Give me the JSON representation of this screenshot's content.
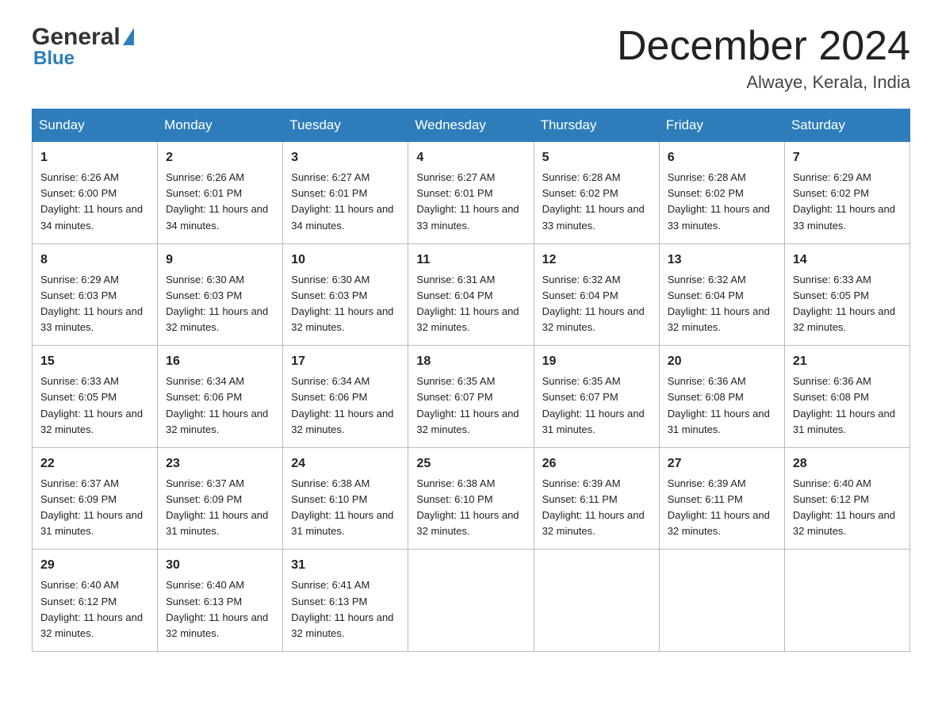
{
  "header": {
    "logo_general": "General",
    "logo_blue": "Blue",
    "month_title": "December 2024",
    "location": "Alwaye, Kerala, India"
  },
  "days_of_week": [
    "Sunday",
    "Monday",
    "Tuesday",
    "Wednesday",
    "Thursday",
    "Friday",
    "Saturday"
  ],
  "weeks": [
    [
      {
        "num": "1",
        "sunrise": "6:26 AM",
        "sunset": "6:00 PM",
        "daylight": "11 hours and 34 minutes."
      },
      {
        "num": "2",
        "sunrise": "6:26 AM",
        "sunset": "6:01 PM",
        "daylight": "11 hours and 34 minutes."
      },
      {
        "num": "3",
        "sunrise": "6:27 AM",
        "sunset": "6:01 PM",
        "daylight": "11 hours and 34 minutes."
      },
      {
        "num": "4",
        "sunrise": "6:27 AM",
        "sunset": "6:01 PM",
        "daylight": "11 hours and 33 minutes."
      },
      {
        "num": "5",
        "sunrise": "6:28 AM",
        "sunset": "6:02 PM",
        "daylight": "11 hours and 33 minutes."
      },
      {
        "num": "6",
        "sunrise": "6:28 AM",
        "sunset": "6:02 PM",
        "daylight": "11 hours and 33 minutes."
      },
      {
        "num": "7",
        "sunrise": "6:29 AM",
        "sunset": "6:02 PM",
        "daylight": "11 hours and 33 minutes."
      }
    ],
    [
      {
        "num": "8",
        "sunrise": "6:29 AM",
        "sunset": "6:03 PM",
        "daylight": "11 hours and 33 minutes."
      },
      {
        "num": "9",
        "sunrise": "6:30 AM",
        "sunset": "6:03 PM",
        "daylight": "11 hours and 32 minutes."
      },
      {
        "num": "10",
        "sunrise": "6:30 AM",
        "sunset": "6:03 PM",
        "daylight": "11 hours and 32 minutes."
      },
      {
        "num": "11",
        "sunrise": "6:31 AM",
        "sunset": "6:04 PM",
        "daylight": "11 hours and 32 minutes."
      },
      {
        "num": "12",
        "sunrise": "6:32 AM",
        "sunset": "6:04 PM",
        "daylight": "11 hours and 32 minutes."
      },
      {
        "num": "13",
        "sunrise": "6:32 AM",
        "sunset": "6:04 PM",
        "daylight": "11 hours and 32 minutes."
      },
      {
        "num": "14",
        "sunrise": "6:33 AM",
        "sunset": "6:05 PM",
        "daylight": "11 hours and 32 minutes."
      }
    ],
    [
      {
        "num": "15",
        "sunrise": "6:33 AM",
        "sunset": "6:05 PM",
        "daylight": "11 hours and 32 minutes."
      },
      {
        "num": "16",
        "sunrise": "6:34 AM",
        "sunset": "6:06 PM",
        "daylight": "11 hours and 32 minutes."
      },
      {
        "num": "17",
        "sunrise": "6:34 AM",
        "sunset": "6:06 PM",
        "daylight": "11 hours and 32 minutes."
      },
      {
        "num": "18",
        "sunrise": "6:35 AM",
        "sunset": "6:07 PM",
        "daylight": "11 hours and 32 minutes."
      },
      {
        "num": "19",
        "sunrise": "6:35 AM",
        "sunset": "6:07 PM",
        "daylight": "11 hours and 31 minutes."
      },
      {
        "num": "20",
        "sunrise": "6:36 AM",
        "sunset": "6:08 PM",
        "daylight": "11 hours and 31 minutes."
      },
      {
        "num": "21",
        "sunrise": "6:36 AM",
        "sunset": "6:08 PM",
        "daylight": "11 hours and 31 minutes."
      }
    ],
    [
      {
        "num": "22",
        "sunrise": "6:37 AM",
        "sunset": "6:09 PM",
        "daylight": "11 hours and 31 minutes."
      },
      {
        "num": "23",
        "sunrise": "6:37 AM",
        "sunset": "6:09 PM",
        "daylight": "11 hours and 31 minutes."
      },
      {
        "num": "24",
        "sunrise": "6:38 AM",
        "sunset": "6:10 PM",
        "daylight": "11 hours and 31 minutes."
      },
      {
        "num": "25",
        "sunrise": "6:38 AM",
        "sunset": "6:10 PM",
        "daylight": "11 hours and 32 minutes."
      },
      {
        "num": "26",
        "sunrise": "6:39 AM",
        "sunset": "6:11 PM",
        "daylight": "11 hours and 32 minutes."
      },
      {
        "num": "27",
        "sunrise": "6:39 AM",
        "sunset": "6:11 PM",
        "daylight": "11 hours and 32 minutes."
      },
      {
        "num": "28",
        "sunrise": "6:40 AM",
        "sunset": "6:12 PM",
        "daylight": "11 hours and 32 minutes."
      }
    ],
    [
      {
        "num": "29",
        "sunrise": "6:40 AM",
        "sunset": "6:12 PM",
        "daylight": "11 hours and 32 minutes."
      },
      {
        "num": "30",
        "sunrise": "6:40 AM",
        "sunset": "6:13 PM",
        "daylight": "11 hours and 32 minutes."
      },
      {
        "num": "31",
        "sunrise": "6:41 AM",
        "sunset": "6:13 PM",
        "daylight": "11 hours and 32 minutes."
      },
      null,
      null,
      null,
      null
    ]
  ]
}
